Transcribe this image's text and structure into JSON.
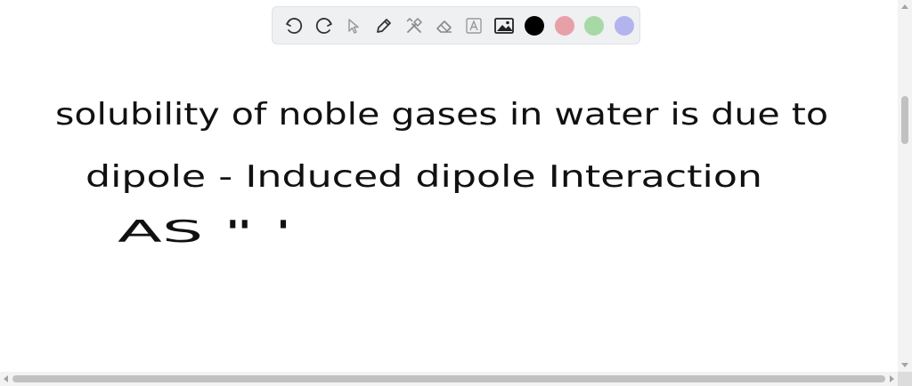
{
  "toolbar": {
    "tools": [
      {
        "name": "undo-icon",
        "label": "Undo"
      },
      {
        "name": "redo-icon",
        "label": "Redo"
      },
      {
        "name": "select-pointer-icon",
        "label": "Select"
      },
      {
        "name": "pen-icon",
        "label": "Pen"
      },
      {
        "name": "tools-icon",
        "label": "Tools"
      },
      {
        "name": "eraser-icon",
        "label": "Eraser"
      },
      {
        "name": "text-icon",
        "label": "A"
      },
      {
        "name": "image-icon",
        "label": "Image"
      }
    ],
    "colors": [
      "#000000",
      "#e8a0a8",
      "#a6d9a6",
      "#b3b3ee"
    ],
    "selected_color": "#000000"
  },
  "canvas": {
    "handwriting": [
      "solubility of noble gases in water is due to",
      "dipole - Induced dipole Interaction",
      "AS \" '"
    ]
  }
}
